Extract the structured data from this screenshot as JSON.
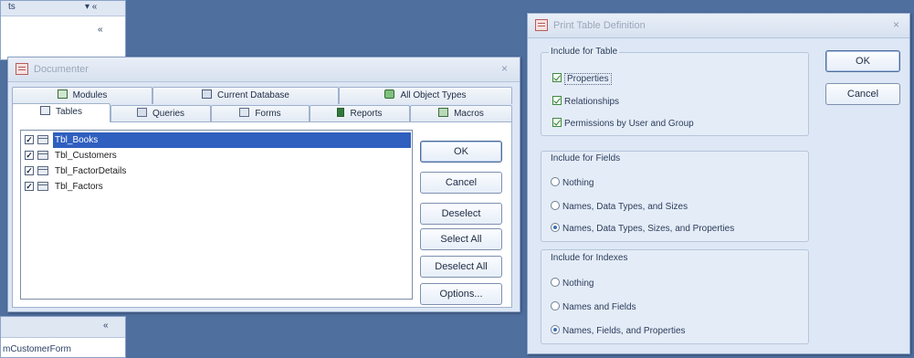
{
  "background_pane": {
    "top_partial_text": "ts",
    "top_icons": "▾ «",
    "top_mid_icon": "«",
    "bottom_mid_icon": "«",
    "bottom_text": "mCustomerForm"
  },
  "documenter": {
    "title": "Documenter",
    "close": "×",
    "tabs_back": [
      {
        "label": "Modules",
        "icon": "modules-icon"
      },
      {
        "label": "Current Database",
        "icon": "current-database-icon"
      },
      {
        "label": "All Object Types",
        "icon": "all-object-types-icon"
      }
    ],
    "tabs_front": [
      {
        "label": "Tables",
        "icon": "tables-icon"
      },
      {
        "label": "Queries",
        "icon": "queries-icon"
      },
      {
        "label": "Forms",
        "icon": "forms-icon"
      },
      {
        "label": "Reports",
        "icon": "reports-icon"
      },
      {
        "label": "Macros",
        "icon": "macros-icon"
      }
    ],
    "items": [
      {
        "label": "Tbl_Books",
        "checked": true,
        "selected": true
      },
      {
        "label": "Tbl_Customers",
        "checked": true,
        "selected": false
      },
      {
        "label": "Tbl_FactorDetails",
        "checked": true,
        "selected": false
      },
      {
        "label": "Tbl_Factors",
        "checked": true,
        "selected": false
      }
    ],
    "buttons": {
      "ok": "OK",
      "cancel": "Cancel",
      "deselect": "Deselect",
      "select_all": "Select All",
      "deselect_all": "Deselect All",
      "options": "Options..."
    }
  },
  "print_table_definition": {
    "title": "Print Table Definition",
    "close": "×",
    "buttons": {
      "ok": "OK",
      "cancel": "Cancel"
    },
    "table_group": {
      "title": "Include for Table",
      "options": [
        {
          "label": "Properties",
          "checked": true
        },
        {
          "label": "Relationships",
          "checked": true
        },
        {
          "label": "Permissions by User and Group",
          "checked": true
        }
      ]
    },
    "fields_group": {
      "title": "Include for Fields",
      "options": [
        {
          "label": "Nothing",
          "selected": false
        },
        {
          "label": "Names, Data Types, and Sizes",
          "selected": false
        },
        {
          "label": "Names, Data Types, Sizes, and Properties",
          "selected": true
        }
      ]
    },
    "indexes_group": {
      "title": "Include for Indexes",
      "options": [
        {
          "label": "Nothing",
          "selected": false
        },
        {
          "label": "Names and Fields",
          "selected": false
        },
        {
          "label": "Names, Fields, and Properties",
          "selected": true
        }
      ]
    }
  }
}
